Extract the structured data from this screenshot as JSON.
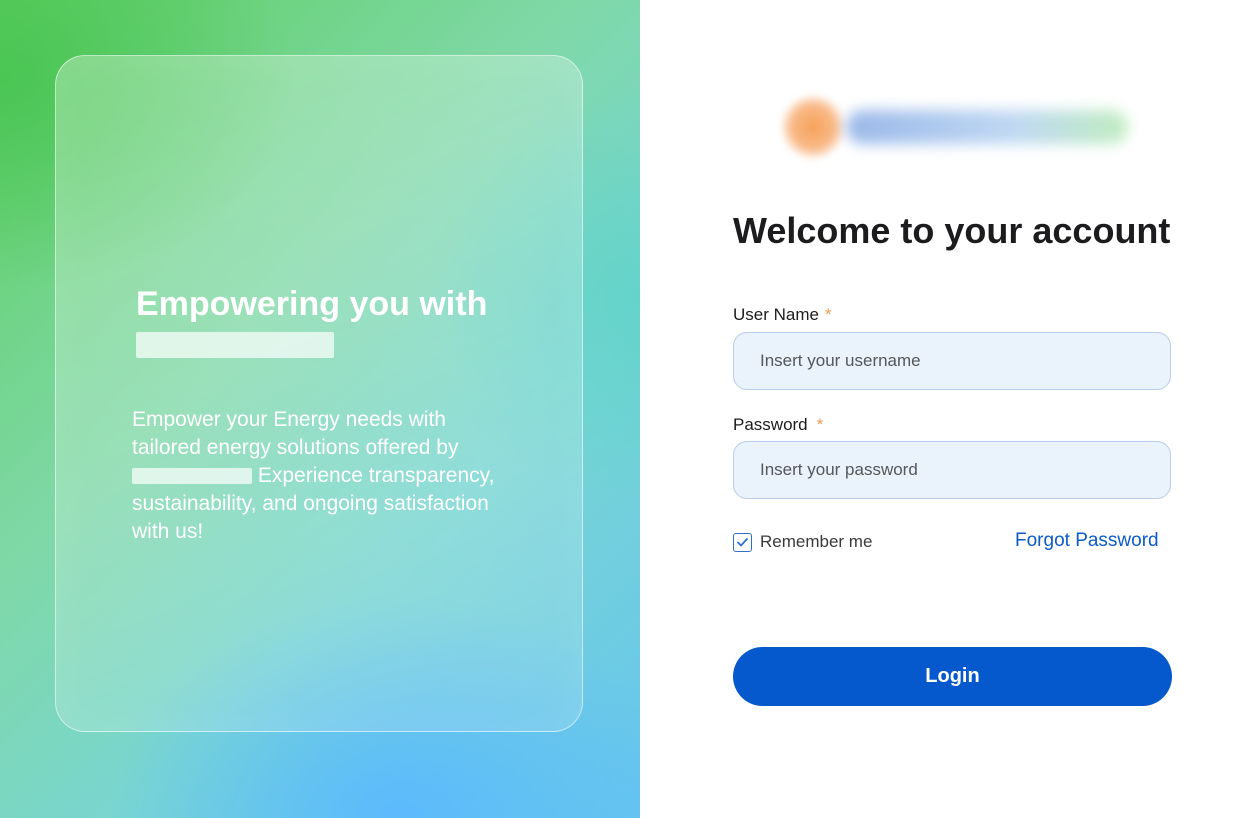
{
  "hero": {
    "title": "Empowering you with",
    "text_before": "Empower your Energy needs with tailored energy solutions offered by",
    "text_after": "Experience transparency, sustainability, and ongoing satisfaction with us!"
  },
  "login": {
    "heading": "Welcome to your account",
    "username": {
      "label": "User Name",
      "required_mark": "*",
      "placeholder": "Insert your username"
    },
    "password": {
      "label": "Password",
      "required_mark": "*",
      "placeholder": "Insert your password"
    },
    "remember_me": {
      "label": "Remember me",
      "checked": true
    },
    "forgot_password": "Forgot Password",
    "submit_label": "Login"
  },
  "icons": {
    "checkbox": "check-icon"
  },
  "colors": {
    "primary": "#0659cc",
    "link": "#0b5bc9",
    "required": "#f29a54",
    "input_background": "#eaf2fb",
    "input_border": "#b6cdec"
  }
}
